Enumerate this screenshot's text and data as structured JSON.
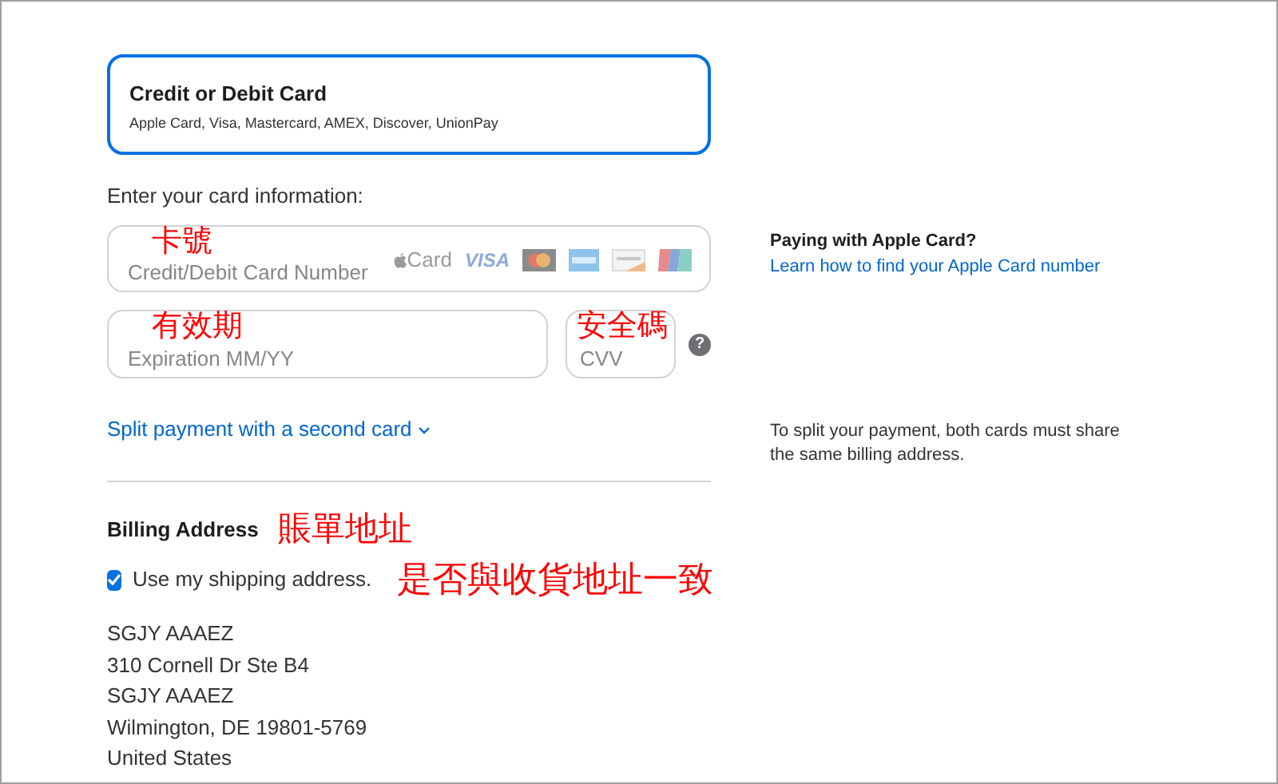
{
  "payment_option": {
    "title": "Credit or Debit Card",
    "subtitle": "Apple Card, Visa, Mastercard, AMEX, Discover, UnionPay",
    "selected": true
  },
  "card_info_label": "Enter your card information:",
  "card_number": {
    "placeholder": "Credit/Debit Card Number",
    "annotation": "卡號"
  },
  "card_logos": [
    {
      "kind": "apple",
      "text": "Card"
    },
    {
      "kind": "wordmark",
      "text": "VISA"
    },
    {
      "kind": "circles"
    },
    {
      "kind": "blue"
    },
    {
      "kind": "stripe"
    },
    {
      "kind": "tricolor"
    }
  ],
  "expiration": {
    "placeholder": "Expiration MM/YY",
    "annotation": "有效期"
  },
  "security_code": {
    "placeholder": "CVV",
    "annotation": "安全碼",
    "help": "?"
  },
  "split_link": "Split payment with a second card",
  "billing": {
    "title": "Billing Address",
    "annotation": "賬單地址",
    "checkbox": {
      "label": "Use my shipping address.",
      "checked": true,
      "annotation": "是否與收貨地址一致"
    },
    "address_lines": [
      "SGJY AAAEZ",
      "310 Cornell Dr Ste B4",
      "SGJY AAAEZ",
      "Wilmington, DE 19801-5769",
      "United States"
    ]
  },
  "apple_card_help": {
    "title": "Paying with Apple Card?",
    "link": "Learn how to find your Apple Card number"
  },
  "split_note": "To split your payment, both cards must share the same billing address."
}
